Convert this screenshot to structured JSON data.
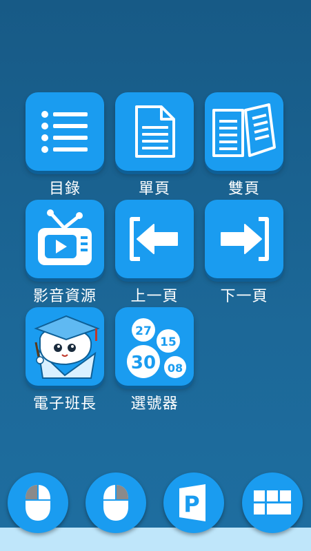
{
  "menu": {
    "items": [
      {
        "label": "目錄",
        "icon": "list-icon"
      },
      {
        "label": "單頁",
        "icon": "single-page-icon"
      },
      {
        "label": "雙頁",
        "icon": "double-page-icon"
      },
      {
        "label": "影音資源",
        "icon": "tv-icon"
      },
      {
        "label": "上一頁",
        "icon": "arrow-left-icon"
      },
      {
        "label": "下一頁",
        "icon": "arrow-right-icon"
      },
      {
        "label": "電子班長",
        "icon": "mascot-icon"
      },
      {
        "label": "選號器",
        "icon": "number-balls-icon"
      }
    ],
    "number_balls": [
      "27",
      "15",
      "30",
      "08"
    ]
  },
  "dock": {
    "items": [
      {
        "icon": "mouse-left-icon"
      },
      {
        "icon": "mouse-right-icon"
      },
      {
        "icon": "powerpoint-icon",
        "glyph": "P"
      },
      {
        "icon": "windows-tiles-icon"
      }
    ]
  },
  "colors": {
    "background": "#175a86",
    "tile": "#1a9cf0",
    "tile_shadow": "#0e5f96",
    "dock_strip": "#bfe6fa"
  }
}
